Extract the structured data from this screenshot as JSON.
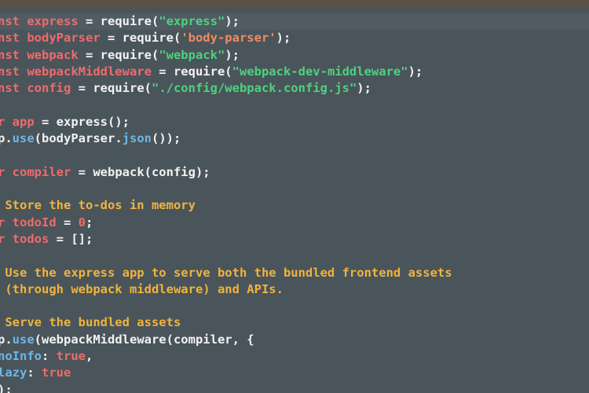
{
  "code_lines": [
    {
      "active": true,
      "tokens": [
        {
          "cls": "kw",
          "text": "nst "
        },
        {
          "cls": "kw",
          "text": "express"
        },
        {
          "cls": "op",
          "text": " = require("
        },
        {
          "cls": "str",
          "text": "\"express\""
        },
        {
          "cls": "op",
          "text": ");"
        }
      ]
    },
    {
      "tokens": [
        {
          "cls": "kw",
          "text": "nst "
        },
        {
          "cls": "kw",
          "text": "bodyParser"
        },
        {
          "cls": "op",
          "text": " = require("
        },
        {
          "cls": "sq",
          "text": "'body-parser'"
        },
        {
          "cls": "op",
          "text": ");"
        }
      ]
    },
    {
      "tokens": [
        {
          "cls": "kw",
          "text": "nst "
        },
        {
          "cls": "kw",
          "text": "webpack"
        },
        {
          "cls": "op",
          "text": " = require("
        },
        {
          "cls": "str",
          "text": "\"webpack\""
        },
        {
          "cls": "op",
          "text": ");"
        }
      ]
    },
    {
      "tokens": [
        {
          "cls": "kw",
          "text": "nst "
        },
        {
          "cls": "kw",
          "text": "webpackMiddleware"
        },
        {
          "cls": "op",
          "text": " = require("
        },
        {
          "cls": "str",
          "text": "\"webpack-dev-middleware\""
        },
        {
          "cls": "op",
          "text": ");"
        }
      ]
    },
    {
      "tokens": [
        {
          "cls": "kw",
          "text": "nst "
        },
        {
          "cls": "kw",
          "text": "config"
        },
        {
          "cls": "op",
          "text": " = require("
        },
        {
          "cls": "str",
          "text": "\"./config/webpack.config.js\""
        },
        {
          "cls": "op",
          "text": ");"
        }
      ]
    },
    {
      "tokens": []
    },
    {
      "tokens": [
        {
          "cls": "kw",
          "text": "r "
        },
        {
          "cls": "kw",
          "text": "app"
        },
        {
          "cls": "op",
          "text": " = express();"
        }
      ]
    },
    {
      "tokens": [
        {
          "cls": "op",
          "text": "p."
        },
        {
          "cls": "fn",
          "text": "use"
        },
        {
          "cls": "op",
          "text": "(bodyParser."
        },
        {
          "cls": "fn",
          "text": "json"
        },
        {
          "cls": "op",
          "text": "());"
        }
      ]
    },
    {
      "tokens": []
    },
    {
      "tokens": [
        {
          "cls": "kw",
          "text": "r "
        },
        {
          "cls": "kw",
          "text": "compiler"
        },
        {
          "cls": "op",
          "text": " = webpack(config);"
        }
      ]
    },
    {
      "tokens": []
    },
    {
      "tokens": [
        {
          "cls": "cmt",
          "text": " Store the to-dos in memory"
        }
      ]
    },
    {
      "tokens": [
        {
          "cls": "kw",
          "text": "r "
        },
        {
          "cls": "kw",
          "text": "todoId"
        },
        {
          "cls": "op",
          "text": " = "
        },
        {
          "cls": "num",
          "text": "0"
        },
        {
          "cls": "op",
          "text": ";"
        }
      ]
    },
    {
      "tokens": [
        {
          "cls": "kw",
          "text": "r "
        },
        {
          "cls": "kw",
          "text": "todos"
        },
        {
          "cls": "op",
          "text": " = [];"
        }
      ]
    },
    {
      "tokens": []
    },
    {
      "tokens": [
        {
          "cls": "cmt",
          "text": " Use the express app to serve both the bundled frontend assets"
        }
      ]
    },
    {
      "tokens": [
        {
          "cls": "cmt",
          "text": " (through webpack middleware) and APIs."
        }
      ]
    },
    {
      "tokens": []
    },
    {
      "tokens": [
        {
          "cls": "cmt",
          "text": " Serve the bundled assets"
        }
      ]
    },
    {
      "tokens": [
        {
          "cls": "op",
          "text": "p."
        },
        {
          "cls": "fn",
          "text": "use"
        },
        {
          "cls": "op",
          "text": "(webpackMiddleware(compiler, {"
        }
      ]
    },
    {
      "tokens": [
        {
          "cls": "prop",
          "text": "noInfo"
        },
        {
          "cls": "op",
          "text": ": "
        },
        {
          "cls": "num",
          "text": "true"
        },
        {
          "cls": "op",
          "text": ","
        }
      ]
    },
    {
      "tokens": [
        {
          "cls": "prop",
          "text": "lazy"
        },
        {
          "cls": "op",
          "text": ": "
        },
        {
          "cls": "num",
          "text": "true"
        }
      ]
    },
    {
      "tokens": [
        {
          "cls": "op",
          "text": ");"
        }
      ]
    }
  ],
  "colors": {
    "background": "#4a545b",
    "active_line": "#515b63",
    "keyword": "#ef6b6b",
    "string": "#4ed27c",
    "single_quote_string": "#f08a60",
    "function": "#6bb7e6",
    "comment": "#f0b43c",
    "text": "#f2f2f2"
  }
}
